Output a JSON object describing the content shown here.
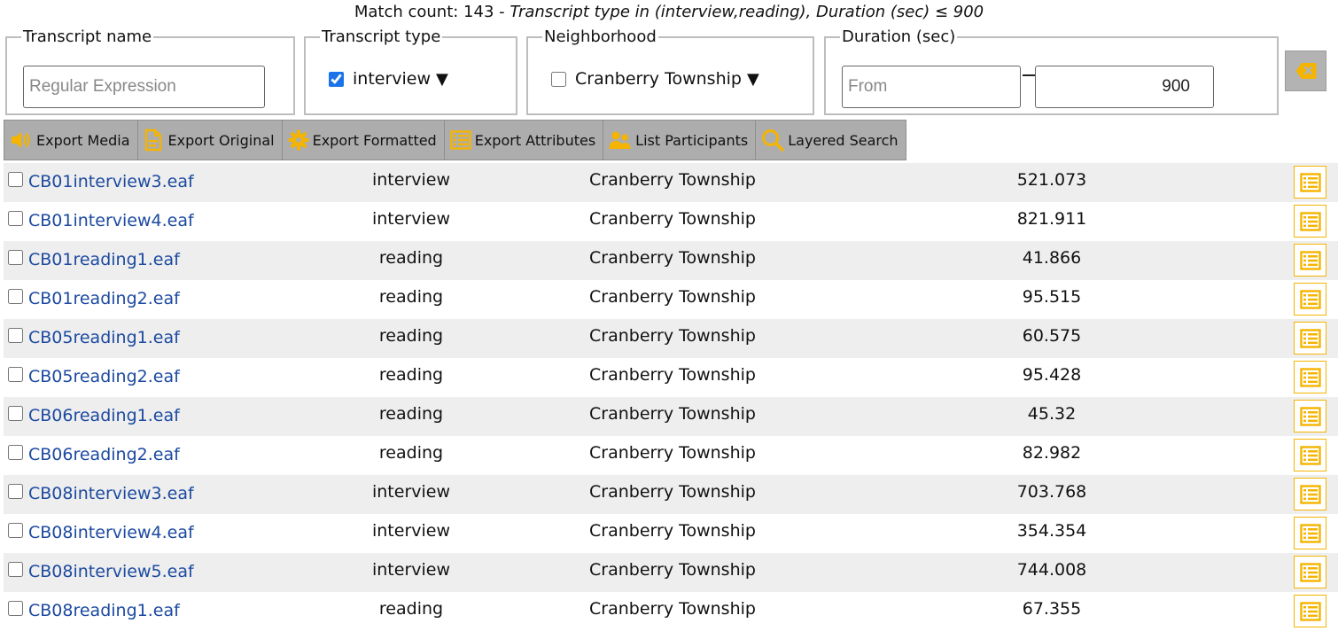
{
  "summary": {
    "prefix": "Match count: 143 - ",
    "filter": "Transcript type in (interview,reading), Duration (sec) ≤ 900"
  },
  "filters": {
    "name": {
      "legend": "Transcript name",
      "placeholder": "Regular Expression",
      "value": ""
    },
    "type": {
      "legend": "Transcript type",
      "selected": "interview",
      "checked": true
    },
    "neighborhood": {
      "legend": "Neighborhood",
      "selected": "Cranberry Township",
      "checked": false
    },
    "duration": {
      "legend": "Duration (sec)",
      "from_placeholder": "From",
      "from_value": "",
      "to_value": "900"
    },
    "dropdown_arrow": "▼"
  },
  "toolbar": {
    "export_media": "Export Media",
    "export_original": "Export Original",
    "export_formatted": "Export Formatted",
    "export_attributes": "Export Attributes",
    "list_participants": "List Participants",
    "layered_search": "Layered Search"
  },
  "colors": {
    "icon_accent": "#f5b400",
    "link": "#1c4aa0",
    "row_alt": "#eeeeee",
    "toolbar_bg": "#adadad"
  },
  "rows": [
    {
      "name": "CB01interview3.eaf",
      "type": "interview",
      "neighborhood": "Cranberry Township",
      "duration": "521.073"
    },
    {
      "name": "CB01interview4.eaf",
      "type": "interview",
      "neighborhood": "Cranberry Township",
      "duration": "821.911"
    },
    {
      "name": "CB01reading1.eaf",
      "type": "reading",
      "neighborhood": "Cranberry Township",
      "duration": "41.866"
    },
    {
      "name": "CB01reading2.eaf",
      "type": "reading",
      "neighborhood": "Cranberry Township",
      "duration": "95.515"
    },
    {
      "name": "CB05reading1.eaf",
      "type": "reading",
      "neighborhood": "Cranberry Township",
      "duration": "60.575"
    },
    {
      "name": "CB05reading2.eaf",
      "type": "reading",
      "neighborhood": "Cranberry Township",
      "duration": "95.428"
    },
    {
      "name": "CB06reading1.eaf",
      "type": "reading",
      "neighborhood": "Cranberry Township",
      "duration": "45.32"
    },
    {
      "name": "CB06reading2.eaf",
      "type": "reading",
      "neighborhood": "Cranberry Township",
      "duration": "82.982"
    },
    {
      "name": "CB08interview3.eaf",
      "type": "interview",
      "neighborhood": "Cranberry Township",
      "duration": "703.768"
    },
    {
      "name": "CB08interview4.eaf",
      "type": "interview",
      "neighborhood": "Cranberry Township",
      "duration": "354.354"
    },
    {
      "name": "CB08interview5.eaf",
      "type": "interview",
      "neighborhood": "Cranberry Township",
      "duration": "744.008"
    },
    {
      "name": "CB08reading1.eaf",
      "type": "reading",
      "neighborhood": "Cranberry Township",
      "duration": "67.355"
    }
  ]
}
